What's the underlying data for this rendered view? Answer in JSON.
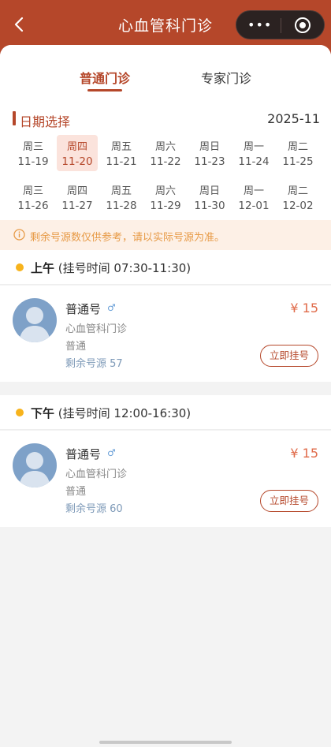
{
  "header": {
    "title": "心血管科门诊",
    "more_label": "•••"
  },
  "tabs": [
    {
      "label": "普通门诊",
      "active": true
    },
    {
      "label": "专家门诊",
      "active": false
    }
  ],
  "date": {
    "title": "日期选择",
    "year_month": "2025-11",
    "days": [
      {
        "week": "周三",
        "date": "11-19"
      },
      {
        "week": "周四",
        "date": "11-20",
        "selected": true
      },
      {
        "week": "周五",
        "date": "11-21"
      },
      {
        "week": "周六",
        "date": "11-22"
      },
      {
        "week": "周日",
        "date": "11-23"
      },
      {
        "week": "周一",
        "date": "11-24"
      },
      {
        "week": "周二",
        "date": "11-25"
      },
      {
        "week": "周三",
        "date": "11-26"
      },
      {
        "week": "周四",
        "date": "11-27"
      },
      {
        "week": "周五",
        "date": "11-28"
      },
      {
        "week": "周六",
        "date": "11-29"
      },
      {
        "week": "周日",
        "date": "11-30"
      },
      {
        "week": "周一",
        "date": "12-01"
      },
      {
        "week": "周二",
        "date": "12-02"
      }
    ]
  },
  "notice": {
    "text": "剩余号源数仅供参考，请以实际号源为准。",
    "icon": "info-icon",
    "color": "#e79a46"
  },
  "sessions": [
    {
      "period": "上午",
      "hours": "(挂号时间 07:30-11:30)",
      "doctor": {
        "name": "普通号",
        "gender_symbol": "♂",
        "dept": "心血管科门诊",
        "level": "普通",
        "remain": "剩余号源 57",
        "price": "¥ 15",
        "button": "立即挂号"
      }
    },
    {
      "period": "下午",
      "hours": "(挂号时间 12:00-16:30)",
      "doctor": {
        "name": "普通号",
        "gender_symbol": "♂",
        "dept": "心血管科门诊",
        "level": "普通",
        "remain": "剩余号源 60",
        "price": "¥ 15",
        "button": "立即挂号"
      }
    }
  ],
  "colors": {
    "brand": "#b5472a",
    "price": "#e06b4a",
    "dot": "#f7b31c"
  }
}
